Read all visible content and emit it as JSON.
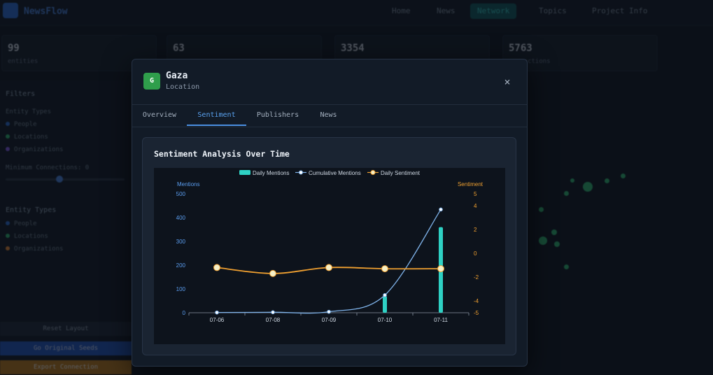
{
  "app": {
    "logo_text": "NewsFlow",
    "nav": [
      "Home",
      "News",
      "Network",
      "Topics",
      "Project Info"
    ],
    "stats": [
      {
        "value": "99",
        "label": "entities"
      },
      {
        "value": "63",
        "label": ""
      },
      {
        "value": "3354",
        "label": ""
      },
      {
        "value": "5763",
        "label": "connections"
      }
    ],
    "sidebar": {
      "filters_title": "Filters",
      "entity_types_label": "Entity Types",
      "filter_items": [
        "People",
        "Locations",
        "Organizations"
      ],
      "min_connections_label": "Minimum Connections: 0",
      "legend_title": "Entity Types",
      "legend_items": [
        "People",
        "Locations",
        "Organizations"
      ],
      "reset_label": "Reset Layout",
      "original_label": "Go Original Seeds",
      "export_label": "Export Connection"
    }
  },
  "modal": {
    "avatar_letter": "G",
    "title": "Gaza",
    "subtitle": "Location",
    "close_icon": "×",
    "tabs": [
      "Overview",
      "Sentiment",
      "Publishers",
      "News"
    ],
    "active_tab": "Sentiment"
  },
  "chart_data": {
    "type": "bar",
    "title": "Sentiment Analysis Over Time",
    "categories": [
      "07-06",
      "07-08",
      "07-09",
      "07-10",
      "07-11"
    ],
    "legend": [
      "Daily Mentions",
      "Cumulative Mentions",
      "Daily Sentiment"
    ],
    "legend_position": "top-center",
    "y_left": {
      "label": "Mentions",
      "ticks": [
        "0",
        "100",
        "200",
        "300",
        "400",
        "500"
      ],
      "range": [
        0,
        500
      ]
    },
    "y_right": {
      "label": "Sentiment",
      "ticks": [
        "-5",
        "-4",
        "-2",
        "0",
        "2",
        "4",
        "5"
      ],
      "range": [
        -5,
        5
      ]
    },
    "series": [
      {
        "name": "Daily Mentions",
        "type": "bar",
        "axis": "left",
        "values": [
          1,
          1,
          2,
          70,
          360
        ],
        "color": "#2ed1c4"
      },
      {
        "name": "Cumulative Mentions",
        "type": "line",
        "axis": "left",
        "values": [
          1,
          2,
          4,
          74,
          434
        ],
        "color": "#7fb3ea"
      },
      {
        "name": "Daily Sentiment",
        "type": "line",
        "axis": "right",
        "values": [
          -1.2,
          -1.7,
          -1.2,
          -1.3,
          -1.3
        ],
        "color": "#f0a030"
      }
    ],
    "grid": false
  }
}
